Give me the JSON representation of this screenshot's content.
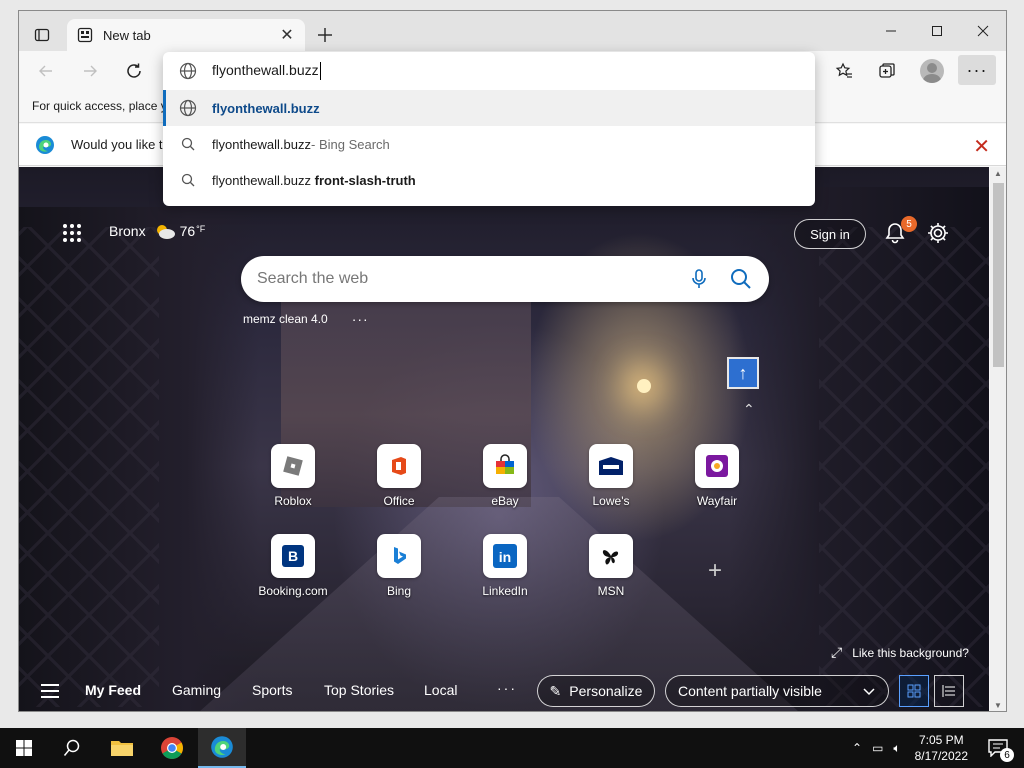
{
  "browser": {
    "tab_title": "New tab",
    "favorites_bar_text": "For quick access, place y",
    "infobar_text": "Would you like t"
  },
  "omnibox": {
    "input_value": "flyonthewall.buzz",
    "suggestions": [
      {
        "prefix": "flyonthewall.buzz",
        "suffix": "",
        "icon": "globe-icon"
      },
      {
        "prefix": "flyonthewall.buzz",
        "suffix": " - Bing Search",
        "icon": "search-icon"
      },
      {
        "prefix": "flyonthewall.buzz ",
        "suffix": "front-slash-truth",
        "icon": "search-icon"
      }
    ]
  },
  "newtab": {
    "weather": {
      "city": "Bronx",
      "temp": "76",
      "unit": "°F"
    },
    "signin_label": "Sign in",
    "notification_count": "5",
    "search_placeholder": "Search the web",
    "pinned_label": "memz clean 4.0",
    "pinned_more": "···",
    "tiles": [
      {
        "label": "Roblox"
      },
      {
        "label": "Office"
      },
      {
        "label": "eBay"
      },
      {
        "label": "Lowe's"
      },
      {
        "label": "Wayfair"
      },
      {
        "label": "Booking.com"
      },
      {
        "label": "Bing"
      },
      {
        "label": "LinkedIn"
      },
      {
        "label": "MSN"
      }
    ],
    "like_background": "Like this background?",
    "nav": {
      "items": [
        "My Feed",
        "Gaming",
        "Sports",
        "Top Stories",
        "Local"
      ],
      "more": "···",
      "personalize": "Personalize",
      "visibility": "Content partially visible"
    }
  },
  "taskbar": {
    "time": "7:05 PM",
    "date": "8/17/2022",
    "notification_count": "6"
  },
  "colors": {
    "accent": "#0f6cbd",
    "badge": "#e8692a",
    "infobar_close": "#c42b1c"
  }
}
